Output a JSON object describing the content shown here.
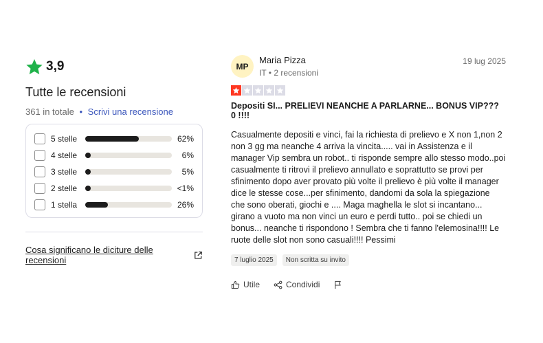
{
  "summary": {
    "score": "3,9",
    "title": "Tutte le recensioni",
    "total": "361 in totale",
    "write_link": "Scrivi una recensione",
    "distribution": [
      {
        "label": "5 stelle",
        "percent_text": "62%",
        "fill": 0.62
      },
      {
        "label": "4 stelle",
        "percent_text": "6%",
        "fill": 0.06
      },
      {
        "label": "3 stelle",
        "percent_text": "5%",
        "fill": 0.05
      },
      {
        "label": "2 stelle",
        "percent_text": "<1%",
        "fill": 0.01
      },
      {
        "label": "1 stella",
        "percent_text": "26%",
        "fill": 0.26
      }
    ],
    "meaning_link": "Cosa significano le diciture delle recensioni"
  },
  "review": {
    "initials": "MP",
    "author": "Maria Pizza",
    "meta": "IT • 2 recensioni",
    "date": "19 lug 2025",
    "rating": 1,
    "title": "Depositi SI... PRELIEVI NEANCHE A PARLARNE... BONUS VIP??? 0 !!!!",
    "body": "Casualmente depositi e vinci, fai la richiesta di prelievo e X non 1,non 2 non 3 gg ma neanche 4 arriva la vincita..... vai in Assistenza e il manager Vip sembra un robot.. ti risponde sempre allo stesso modo..poi casualmente ti ritrovi il prelievo annullato e soprattutto se provi per sfinimento dopo aver provato più volte il prelievo è più volte il manager dice le stesse cose...per sfinimento, dandomi da sola la spiegazione che sono oberati, giochi e .... Maga maghella le slot si incantano... girano a vuoto ma non vinci un euro e perdi tutto.. poi se chiedi un bonus... neanche ti rispondono ! Sembra che ti fanno l'elemosina!!!! Le ruote delle slot non sono casuali!!!! Pessimi",
    "tag_date": "7 luglio 2025",
    "tag_invite": "Non scritta su invito",
    "useful_label": "Utile",
    "share_label": "Condividi"
  },
  "colors": {
    "score_star": "#20b24a",
    "rating_red": "#ff3722",
    "rating_empty": "#dcdce6",
    "link_blue": "#3c57bc"
  },
  "icons": [
    "green-star-icon",
    "external-link-icon",
    "thumbs-up-icon",
    "share-icon",
    "flag-icon"
  ]
}
